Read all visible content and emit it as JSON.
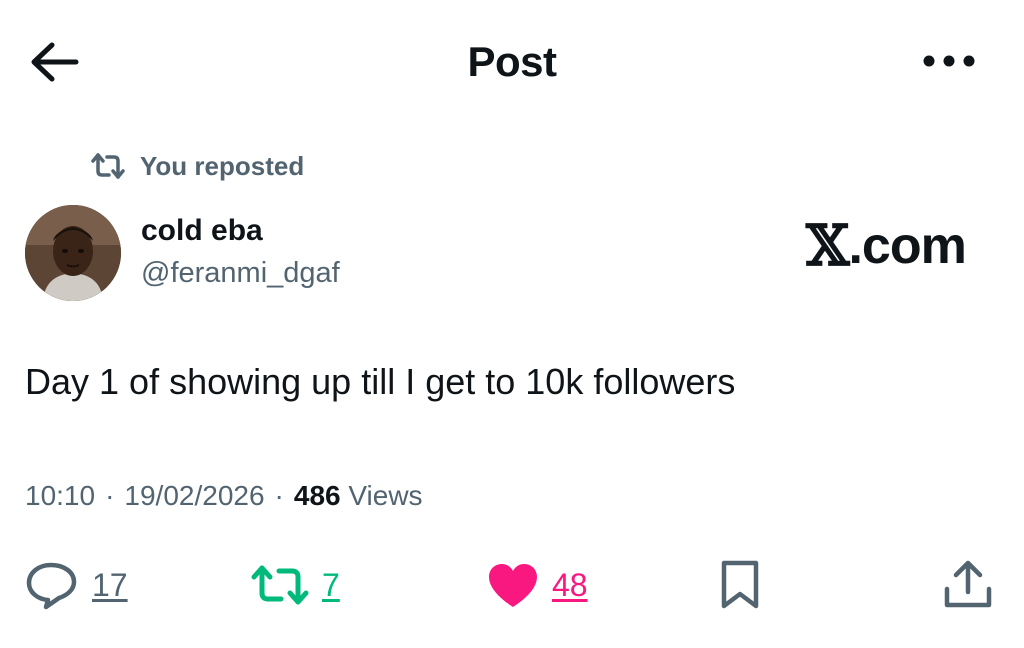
{
  "header": {
    "title": "Post",
    "back_icon": "arrow-left-icon",
    "more_icon": "more-horizontal-icon"
  },
  "repost_banner": {
    "icon": "repost-icon",
    "text": "You reposted"
  },
  "author": {
    "name": "cold eba",
    "handle": "@feranmi_dgaf",
    "avatar_icon": "avatar-photo"
  },
  "watermark": {
    "x_glyph": "𝕏",
    "text": ".com"
  },
  "post": {
    "text": "Day 1 of showing up till I get to 10k followers"
  },
  "meta": {
    "time": "10:10",
    "separator": "·",
    "date": "19/02/2026",
    "views_count": "486",
    "views_label": "Views"
  },
  "actions": {
    "reply": {
      "icon": "reply-icon",
      "count": "17"
    },
    "repost": {
      "icon": "repost-icon",
      "count": "7",
      "active": true
    },
    "like": {
      "icon": "heart-icon",
      "count": "48",
      "active": true
    },
    "bookmark": {
      "icon": "bookmark-icon"
    },
    "share": {
      "icon": "share-icon"
    }
  },
  "colors": {
    "text_primary": "#0f1419",
    "text_secondary": "#536471",
    "repost_green": "#00ba7c",
    "like_pink": "#f91880",
    "background": "#ffffff"
  }
}
